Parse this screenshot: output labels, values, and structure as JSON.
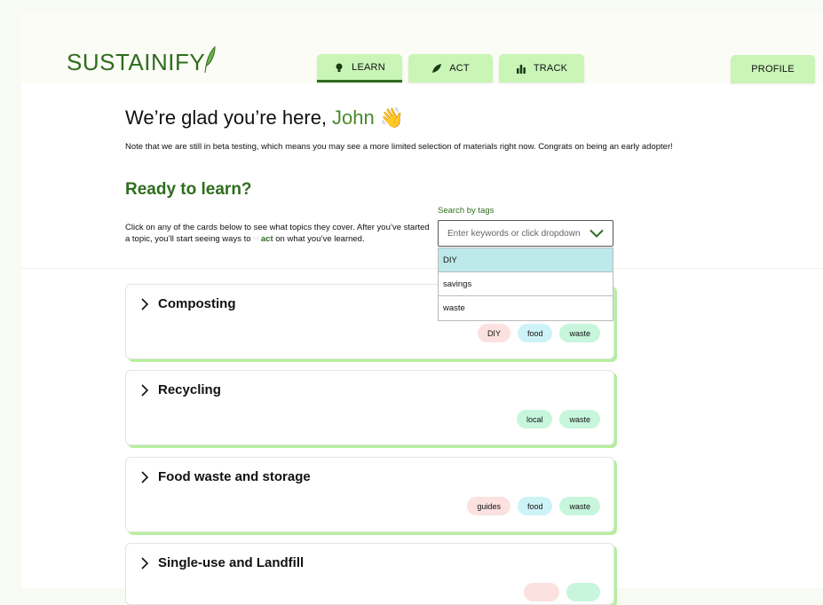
{
  "app": {
    "logo_text": "SUSTAINIF",
    "logo_tail": "Y"
  },
  "nav": {
    "tabs": [
      {
        "label": "LEARN",
        "icon": "lightbulb-icon",
        "active": true
      },
      {
        "label": "ACT",
        "icon": "leaf-icon",
        "active": false
      },
      {
        "label": "TRACK",
        "icon": "bar-chart-icon",
        "active": false
      }
    ],
    "profile_label": "PROFILE"
  },
  "greeting": {
    "prefix": "We’re glad you’re here,",
    "name": "John",
    "emoji": "👋"
  },
  "beta_note": "Note that we are still in beta testing, which means you may see a more limited selection of materials right now. Congrats on being an early adopter!",
  "section_title": "Ready to learn?",
  "instructions": {
    "before": "Click on any of the cards below to see what topics they cover. After you’ve started a topic, you’ll start seeing ways to",
    "act_word": "act",
    "after": "on what you’ve learned."
  },
  "search": {
    "label": "Search by tags",
    "placeholder": "Enter keywords or click dropdown",
    "options": [
      {
        "label": "DIY",
        "selected": true
      },
      {
        "label": "savings",
        "selected": false
      },
      {
        "label": "waste",
        "selected": false
      }
    ]
  },
  "cards": [
    {
      "title": "Composting",
      "tags": [
        {
          "label": "DIY",
          "color": "pink"
        },
        {
          "label": "food",
          "color": "blue"
        },
        {
          "label": "waste",
          "color": "green"
        }
      ]
    },
    {
      "title": "Recycling",
      "tags": [
        {
          "label": "local",
          "color": "green"
        },
        {
          "label": "waste",
          "color": "green"
        }
      ]
    },
    {
      "title": "Food waste and storage",
      "tags": [
        {
          "label": "guides",
          "color": "pink"
        },
        {
          "label": "food",
          "color": "blue"
        },
        {
          "label": "waste",
          "color": "green"
        }
      ]
    },
    {
      "title": "Single-use and Landfill",
      "tags": []
    }
  ],
  "colors": {
    "brand_green": "#2f6d1e",
    "tab_green": "#c9f5b7",
    "card_shadow": "#b5ee9d",
    "tag_pink": "#fbe1df",
    "tag_blue": "#cdf3f7",
    "tag_green": "#c7f6dc",
    "dropdown_selected": "#bde9ea"
  }
}
